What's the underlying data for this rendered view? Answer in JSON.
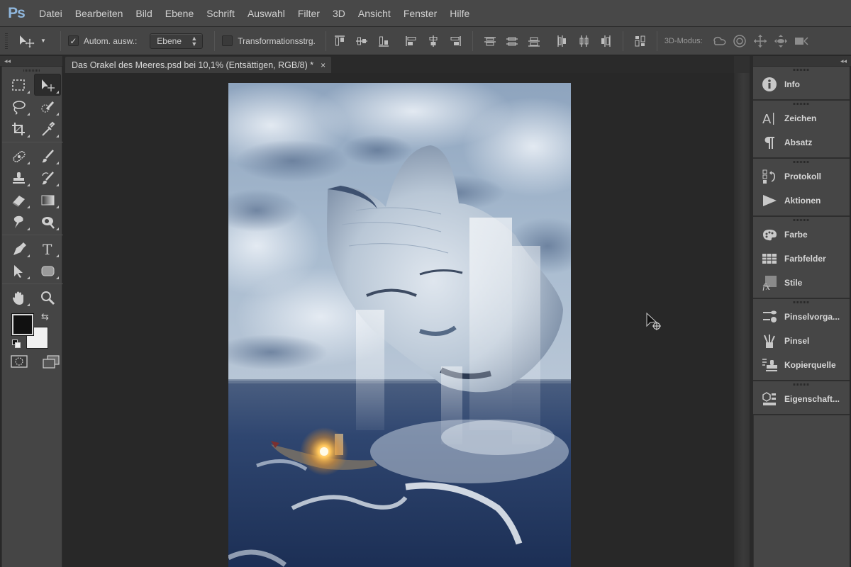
{
  "app": {
    "logo": "Ps",
    "menu": [
      "Datei",
      "Bearbeiten",
      "Bild",
      "Ebene",
      "Schrift",
      "Auswahl",
      "Filter",
      "3D",
      "Ansicht",
      "Fenster",
      "Hilfe"
    ]
  },
  "options": {
    "tool_icon": "move-tool-icon",
    "auto_select_checked": true,
    "auto_select_label": "Autom. ausw.:",
    "auto_select_value": "Ebene",
    "transform_controls_checked": false,
    "transform_controls_label": "Transformationsstrg.",
    "align_icons": [
      "align-top-edges-icon",
      "align-vertical-centers-icon",
      "align-bottom-edges-icon",
      "align-left-edges-icon",
      "align-horizontal-centers-icon",
      "align-right-edges-icon",
      "distribute-top-edges-icon",
      "distribute-vertical-centers-icon",
      "distribute-bottom-edges-icon",
      "distribute-left-edges-icon",
      "distribute-horizontal-centers-icon",
      "distribute-right-edges-icon",
      "auto-align-layers-icon"
    ],
    "mode_label": "3D-Modus:",
    "mode_icons": [
      "rotate-3d-icon",
      "roll-3d-icon",
      "drag-3d-icon",
      "slide-3d-icon",
      "scale-3d-camera-icon"
    ],
    "checkmark": "✓"
  },
  "document": {
    "tab_title": "Das Orakel des Meeres.psd bei 10,1% (Entsättigen, RGB/8) *",
    "close_glyph": "×",
    "zoom": "10,1%",
    "layer": "Entsättigen",
    "color_mode": "RGB/8"
  },
  "toolbox": {
    "collapse_glyph": "◂◂",
    "tools": [
      [
        "rectangular-marquee-tool",
        "move-tool"
      ],
      [
        "lasso-tool",
        "quick-selection-tool"
      ],
      [
        "crop-tool",
        "eyedropper-tool"
      ],
      [
        "spot-healing-brush-tool",
        "brush-tool"
      ],
      [
        "clone-stamp-tool",
        "history-brush-tool"
      ],
      [
        "eraser-tool",
        "gradient-tool"
      ],
      [
        "smudge-tool",
        "dodge-tool"
      ],
      [
        "pen-tool",
        "type-tool"
      ],
      [
        "path-selection-tool",
        "rounded-rectangle-tool"
      ],
      [
        "hand-tool",
        "zoom-tool"
      ]
    ],
    "active_tool": "move-tool",
    "foreground_color": "#111111",
    "background_color": "#f1f1f1",
    "swap_glyph": "⇆",
    "type_glyph": "T"
  },
  "dock": {
    "collapse_glyph": "◂◂",
    "groups": [
      [
        {
          "label": "Info",
          "icon": "info-icon"
        }
      ],
      [
        {
          "label": "Zeichen",
          "icon": "character-icon"
        },
        {
          "label": "Absatz",
          "icon": "paragraph-icon"
        }
      ],
      [
        {
          "label": "Protokoll",
          "icon": "history-icon"
        },
        {
          "label": "Aktionen",
          "icon": "actions-play-icon"
        }
      ],
      [
        {
          "label": "Farbe",
          "icon": "color-palette-icon"
        },
        {
          "label": "Farbfelder",
          "icon": "swatches-icon"
        },
        {
          "label": "Stile",
          "icon": "styles-fx-icon"
        }
      ],
      [
        {
          "label": "Pinselvorga...",
          "icon": "brush-presets-icon"
        },
        {
          "label": "Pinsel",
          "icon": "brushes-icon"
        },
        {
          "label": "Kopierquelle",
          "icon": "clone-source-icon"
        }
      ],
      [
        {
          "label": "Eigenschaft...",
          "icon": "properties-icon"
        }
      ]
    ],
    "glyphs": {
      "character": "A|",
      "paragraph": "¶",
      "info": "i"
    }
  },
  "artwork": {
    "description": "Surreal composite: giant stone face in cloudy sky with water pouring off, small boat with glowing lantern on stormy sea"
  }
}
